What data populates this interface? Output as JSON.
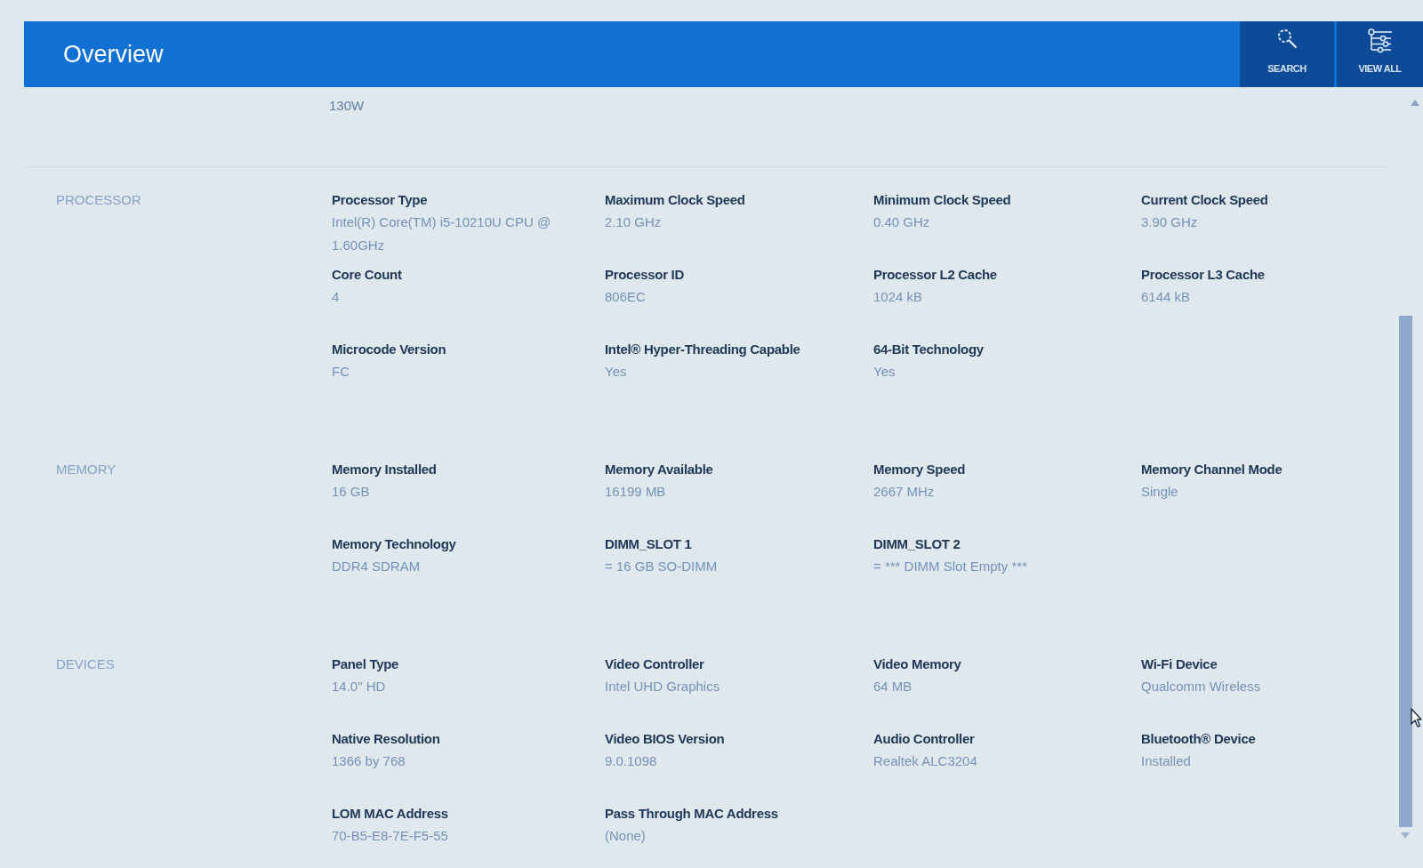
{
  "header": {
    "title": "Overview",
    "actions": [
      {
        "kind": "search",
        "label": "SEARCH"
      },
      {
        "kind": "view_all",
        "label": "VIEW ALL"
      }
    ]
  },
  "partial_row": {
    "value": "130W"
  },
  "sections": [
    {
      "title": "PROCESSOR",
      "fields": [
        {
          "label": "Processor Type",
          "value": "Intel(R) Core(TM) i5-10210U CPU @ 1.60GHz"
        },
        {
          "label": "Maximum Clock Speed",
          "value": "2.10 GHz"
        },
        {
          "label": "Minimum Clock Speed",
          "value": "0.40 GHz"
        },
        {
          "label": "Current Clock Speed",
          "value": "3.90 GHz"
        },
        {
          "label": "Core Count",
          "value": "4"
        },
        {
          "label": "Processor ID",
          "value": "806EC"
        },
        {
          "label": "Processor L2 Cache",
          "value": "1024 kB"
        },
        {
          "label": "Processor L3 Cache",
          "value": "6144 kB"
        },
        {
          "label": "Microcode Version",
          "value": "FC"
        },
        {
          "label": "Intel® Hyper-Threading Capable",
          "value": "Yes"
        },
        {
          "label": "64-Bit Technology",
          "value": "Yes"
        }
      ]
    },
    {
      "title": "MEMORY",
      "fields": [
        {
          "label": "Memory Installed",
          "value": "16 GB"
        },
        {
          "label": "Memory Available",
          "value": "16199 MB"
        },
        {
          "label": "Memory Speed",
          "value": "2667 MHz"
        },
        {
          "label": "Memory Channel Mode",
          "value": "Single"
        },
        {
          "label": "Memory Technology",
          "value": "DDR4 SDRAM"
        },
        {
          "label": "DIMM_SLOT 1",
          "value": "= 16 GB SO-DIMM"
        },
        {
          "label": "DIMM_SLOT 2",
          "value": "= *** DIMM Slot Empty ***"
        }
      ]
    },
    {
      "title": "DEVICES",
      "fields": [
        {
          "label": "Panel Type",
          "value": "14.0\" HD"
        },
        {
          "label": "Video Controller",
          "value": "Intel UHD Graphics"
        },
        {
          "label": "Video Memory",
          "value": "64 MB"
        },
        {
          "label": "Wi-Fi Device",
          "value": "Qualcomm Wireless"
        },
        {
          "label": "Native Resolution",
          "value": "1366 by 768"
        },
        {
          "label": "Video BIOS Version",
          "value": "9.0.1098"
        },
        {
          "label": "Audio Controller",
          "value": "Realtek ALC3204"
        },
        {
          "label": "Bluetooth® Device",
          "value": "Installed"
        },
        {
          "label": "LOM MAC Address",
          "value": "70-B5-E8-7E-F5-55"
        },
        {
          "label": "Pass Through MAC Address",
          "value": "(None)"
        }
      ]
    }
  ]
}
